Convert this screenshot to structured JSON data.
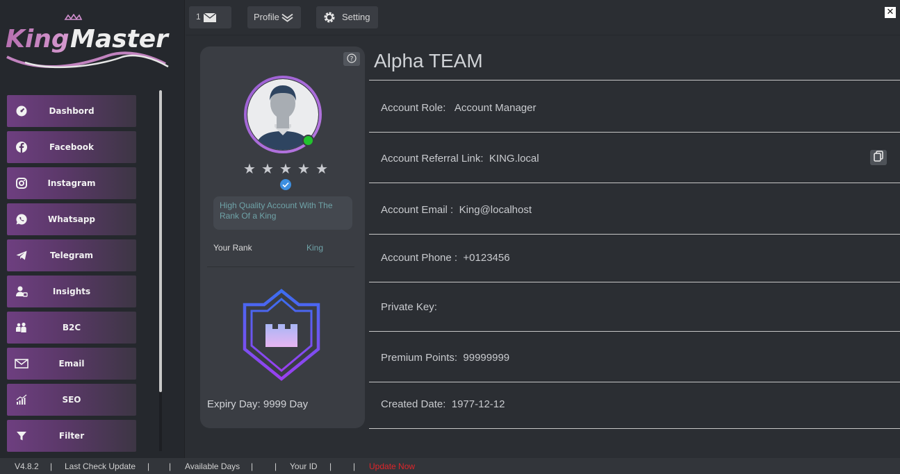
{
  "brand": {
    "logo_text_1": "King",
    "logo_text_2": "Master"
  },
  "sidebar": {
    "items": [
      {
        "label": "Dashbord",
        "icon": "dashboard-gauge-icon"
      },
      {
        "label": "Facebook",
        "icon": "facebook-icon"
      },
      {
        "label": "Instagram",
        "icon": "instagram-icon"
      },
      {
        "label": "Whatsapp",
        "icon": "whatsapp-icon"
      },
      {
        "label": "Telegram",
        "icon": "telegram-icon"
      },
      {
        "label": "Insights",
        "icon": "user-insights-icon"
      },
      {
        "label": "B2C",
        "icon": "group-icon"
      },
      {
        "label": "Email",
        "icon": "envelope-icon"
      },
      {
        "label": "SEO",
        "icon": "seo-chart-icon"
      },
      {
        "label": "Filter",
        "icon": "filter-icon"
      }
    ]
  },
  "topbar": {
    "messages_count": "1",
    "profile_label": "Profile",
    "setting_label": "Setting",
    "close_label": "✕"
  },
  "profile_card": {
    "description": "High Quality Account With The Rank Of a King",
    "rank_label": "Your Rank",
    "rank_value": "King",
    "stars": [
      "★",
      "★",
      "★",
      "★",
      "★"
    ],
    "expiry_label": "Expiry Day:",
    "expiry_value": "9999 Day",
    "online_status_color": "#22c32e"
  },
  "account": {
    "team_name": "Alpha TEAM",
    "rows": [
      {
        "label": "Account Role:",
        "value": "Account Manager"
      },
      {
        "label": "Account Referral Link:",
        "value": "KING.local"
      },
      {
        "label": "Account Email :",
        "value": "King@localhost"
      },
      {
        "label": "Account Phone :",
        "value": "+0123456"
      },
      {
        "label": "Private Key:",
        "value": ""
      },
      {
        "label": "Premium Points:",
        "value": "99999999"
      },
      {
        "label": "Created Date:",
        "value": "1977-12-12"
      }
    ]
  },
  "statusbar": {
    "version": "V4.8.2",
    "last_check": "Last Check Update",
    "available_days": "Available Days",
    "your_id": "Your ID",
    "update_now": "Update Now",
    "separator": "|"
  },
  "colors": {
    "accent_purple": "#8f55c9",
    "rank_teal": "#6fa3a8",
    "update_red": "#e0252a"
  }
}
